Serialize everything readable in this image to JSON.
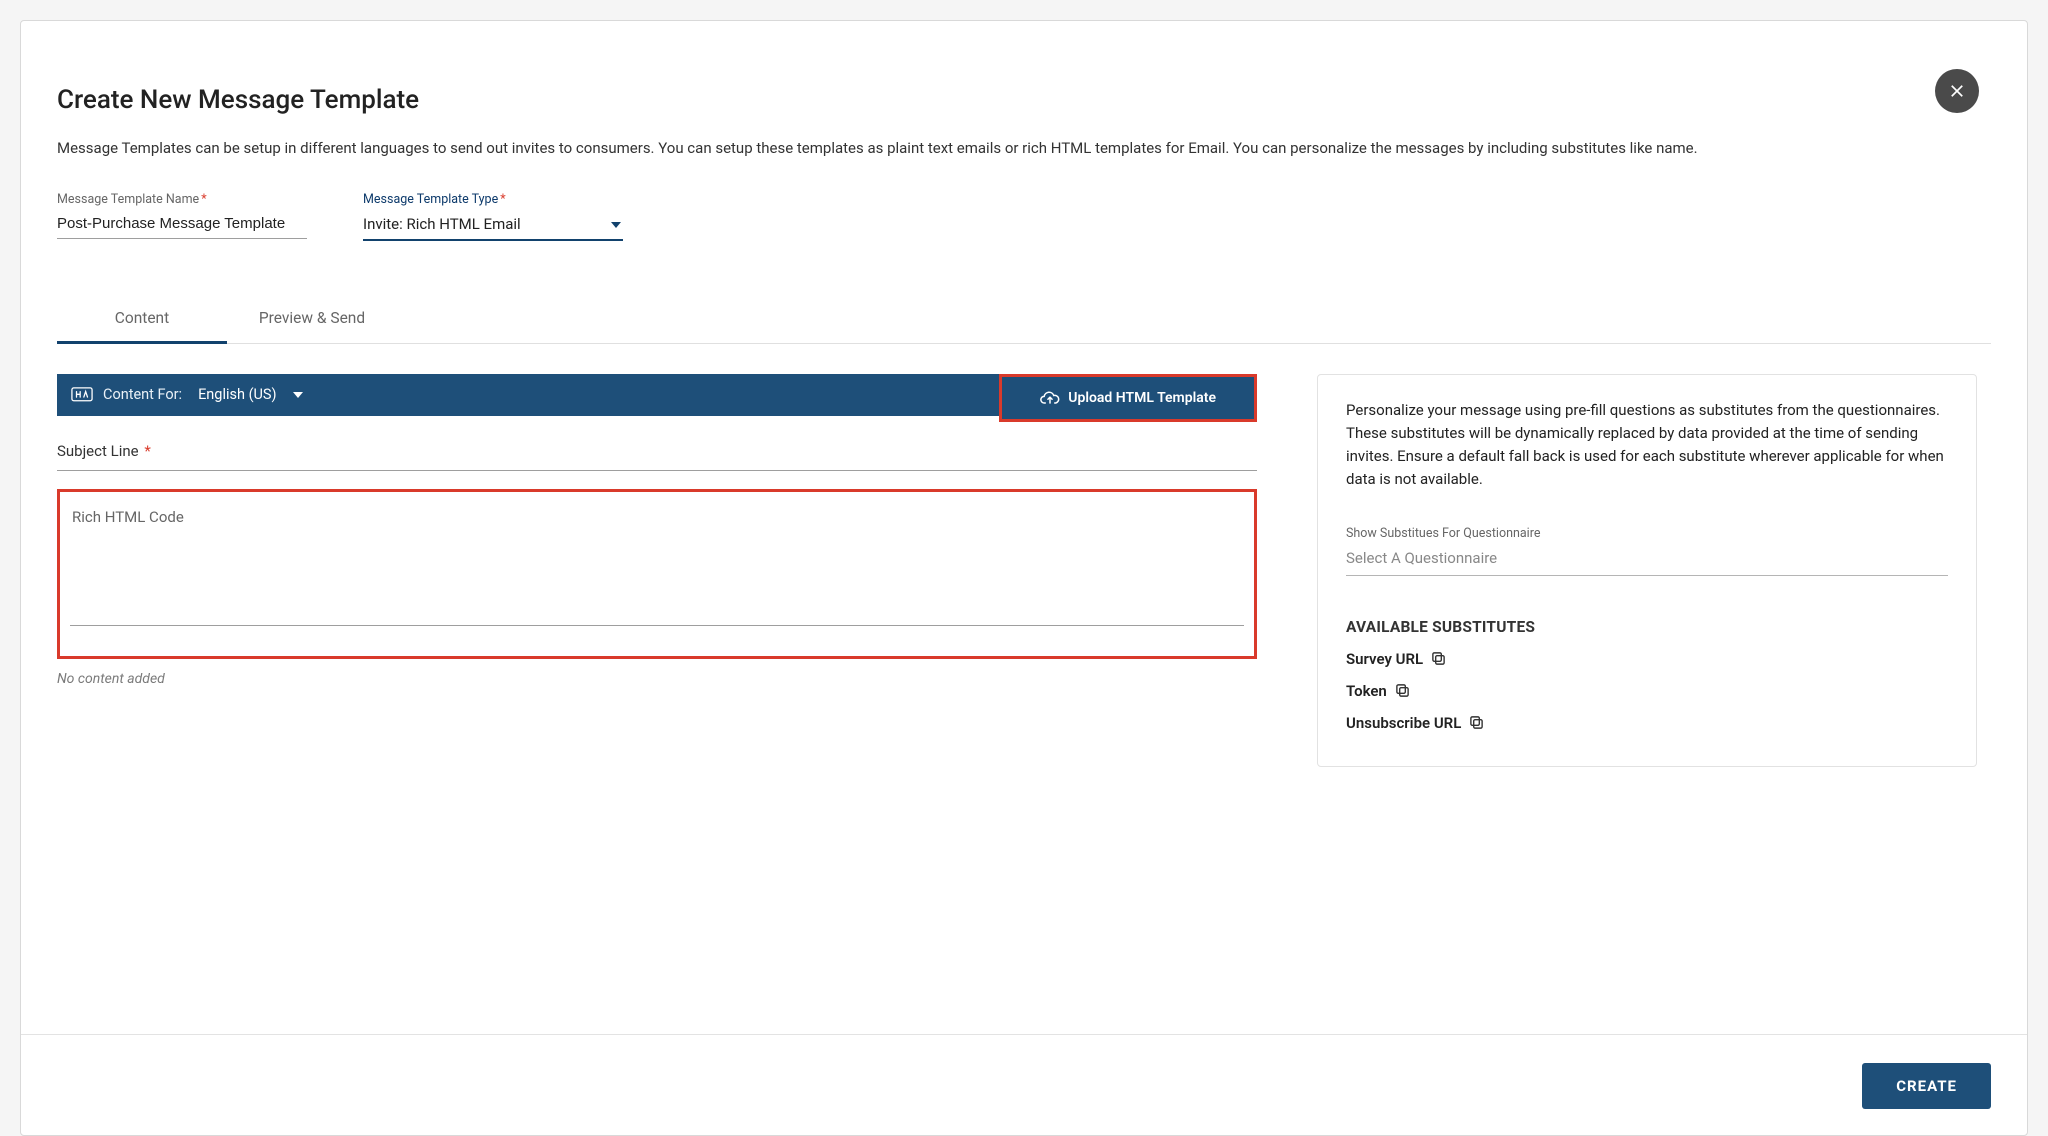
{
  "header": {
    "title": "Create New Message Template",
    "description": "Message Templates can be setup in different languages to send out invites to consumers. You can setup these templates as plaint text emails or rich HTML templates for Email. You can personalize the messages by including substitutes like name."
  },
  "fields": {
    "name_label": "Message Template Name",
    "name_value": "Post-Purchase Message Template",
    "type_label": "Message Template Type",
    "type_value": "Invite: Rich HTML Email"
  },
  "tabs": {
    "content": "Content",
    "preview": "Preview & Send"
  },
  "bluebar": {
    "content_for": "Content For:",
    "language": "English (US)",
    "upload_label": "Upload HTML Template"
  },
  "subject": {
    "label": "Subject Line"
  },
  "rich": {
    "placeholder": "Rich HTML Code",
    "no_content": "No content added"
  },
  "side": {
    "description": "Personalize your message using pre-fill questions as substitutes from the questionnaires. These substitutes will be dynamically replaced by data provided at the time of sending invites. Ensure a default fall back is used for each substitute wherever applicable for when data is not available.",
    "q_label": "Show Substitues For Questionnaire",
    "q_placeholder": "Select A Questionnaire",
    "avail_title": "AVAILABLE SUBSTITUTES",
    "subs": {
      "0": "Survey URL",
      "1": "Token",
      "2": "Unsubscribe URL"
    }
  },
  "footer": {
    "create": "CREATE"
  }
}
